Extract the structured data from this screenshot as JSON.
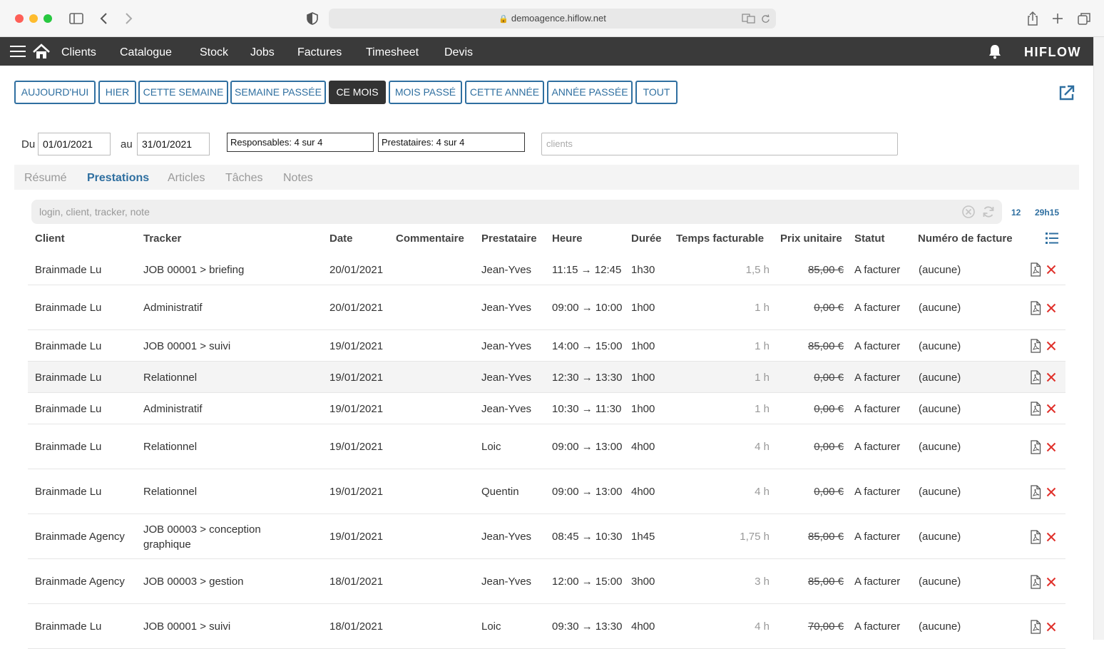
{
  "browser": {
    "url": "demoagence.hiflow.net"
  },
  "nav": {
    "items": [
      "Clients",
      "Catalogue",
      "Stock",
      "Jobs",
      "Factures",
      "Timesheet",
      "Devis"
    ],
    "logo": "HIFLOW"
  },
  "periods": {
    "buttons": [
      "AUJOURD'HUI",
      "HIER",
      "CETTE SEMAINE",
      "SEMAINE PASSÉE",
      "CE MOIS",
      "MOIS PASSÉ",
      "CETTE ANNÉE",
      "ANNÉE PASSÉE",
      "TOUT"
    ],
    "active": "CE MOIS"
  },
  "filters": {
    "from_label": "Du",
    "from_value": "01/01/2021",
    "to_label": "au",
    "to_value": "31/01/2021",
    "responsables": "Responsables: 4 sur 4",
    "prestataires": "Prestataires: 4 sur 4",
    "clients_placeholder": "clients"
  },
  "tabs": {
    "items": [
      "Résumé",
      "Prestations",
      "Articles",
      "Tâches",
      "Notes"
    ],
    "active": "Prestations"
  },
  "search": {
    "placeholder": "login, client, tracker, note",
    "count": "12",
    "total": "29h15"
  },
  "table": {
    "headers": [
      "Client",
      "Tracker",
      "Date",
      "Commentaire",
      "Prestataire",
      "Heure",
      "Durée",
      "Temps facturable",
      "Prix unitaire",
      "Statut",
      "Numéro de facture"
    ],
    "rows": [
      {
        "client": "Brainmade Lu",
        "tracker": "JOB 00001 > briefing",
        "date": "20/01/2021",
        "comment": "",
        "prestataire": "Jean-Yves",
        "heure": "11:15 → 12:45",
        "duree": "1h30",
        "temps": "1,5 h",
        "prix": "85,00 €",
        "statut": "A facturer",
        "facture": "(aucune)"
      },
      {
        "client": "Brainmade Lu",
        "tracker": "Administratif",
        "date": "20/01/2021",
        "comment": "",
        "prestataire": "Jean-Yves",
        "heure": "09:00 → 10:00",
        "duree": "1h00",
        "temps": "1 h",
        "prix": "0,00 €",
        "statut": "A facturer",
        "facture": "(aucune)"
      },
      {
        "client": "Brainmade Lu",
        "tracker": "JOB 00001 > suivi",
        "date": "19/01/2021",
        "comment": "",
        "prestataire": "Jean-Yves",
        "heure": "14:00 → 15:00",
        "duree": "1h00",
        "temps": "1 h",
        "prix": "85,00 €",
        "statut": "A facturer",
        "facture": "(aucune)"
      },
      {
        "client": "Brainmade Lu",
        "tracker": "Relationnel",
        "date": "19/01/2021",
        "comment": "",
        "prestataire": "Jean-Yves",
        "heure": "12:30 → 13:30",
        "duree": "1h00",
        "temps": "1 h",
        "prix": "0,00 €",
        "statut": "A facturer",
        "facture": "(aucune)"
      },
      {
        "client": "Brainmade Lu",
        "tracker": "Administratif",
        "date": "19/01/2021",
        "comment": "",
        "prestataire": "Jean-Yves",
        "heure": "10:30 → 11:30",
        "duree": "1h00",
        "temps": "1 h",
        "prix": "0,00 €",
        "statut": "A facturer",
        "facture": "(aucune)"
      },
      {
        "client": "Brainmade Lu",
        "tracker": "Relationnel",
        "date": "19/01/2021",
        "comment": "",
        "prestataire": "Loic",
        "heure": "09:00 → 13:00",
        "duree": "4h00",
        "temps": "4 h",
        "prix": "0,00 €",
        "statut": "A facturer",
        "facture": "(aucune)"
      },
      {
        "client": "Brainmade Lu",
        "tracker": "Relationnel",
        "date": "19/01/2021",
        "comment": "",
        "prestataire": "Quentin",
        "heure": "09:00 → 13:00",
        "duree": "4h00",
        "temps": "4 h",
        "prix": "0,00 €",
        "statut": "A facturer",
        "facture": "(aucune)"
      },
      {
        "client": "Brainmade Agency",
        "tracker": "JOB 00003 > conception graphique",
        "date": "19/01/2021",
        "comment": "",
        "prestataire": "Jean-Yves",
        "heure": "08:45 → 10:30",
        "duree": "1h45",
        "temps": "1,75 h",
        "prix": "85,00 €",
        "statut": "A facturer",
        "facture": "(aucune)"
      },
      {
        "client": "Brainmade Agency",
        "tracker": "JOB 00003 > gestion",
        "date": "18/01/2021",
        "comment": "",
        "prestataire": "Jean-Yves",
        "heure": "12:00 → 15:00",
        "duree": "3h00",
        "temps": "3 h",
        "prix": "85,00 €",
        "statut": "A facturer",
        "facture": "(aucune)"
      },
      {
        "client": "Brainmade Lu",
        "tracker": "JOB 00001 > suivi",
        "date": "18/01/2021",
        "comment": "",
        "prestataire": "Loic",
        "heure": "09:30 → 13:30",
        "duree": "4h00",
        "temps": "4 h",
        "prix": "70,00 €",
        "statut": "A facturer",
        "facture": "(aucune)"
      }
    ]
  }
}
